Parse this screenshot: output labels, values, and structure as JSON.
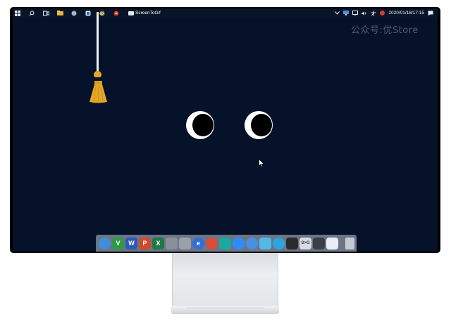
{
  "taskbar": {
    "pinned": [
      "windows-start-icon",
      "search-icon",
      "task-view-icon",
      "file-explorer-icon",
      "app-icon-1",
      "app-icon-2",
      "chrome-icon",
      "record-icon"
    ],
    "active_app_label": "ScreenToGif",
    "tray_icons": [
      "chevron-up-icon",
      "network-icon",
      "display-icon",
      "volume-icon",
      "input-icon",
      "antivirus-icon"
    ],
    "clock": "2020/01/18/17:15",
    "notification_icon": "notification-icon"
  },
  "watermark": "公众号:优Store",
  "desktop": {
    "lamp_color": "#e3a627",
    "eye_color": "#ffffff",
    "background_color": "#061229"
  },
  "dock": {
    "background_color": "#6b7587",
    "apps": [
      {
        "name": "dock-app-1",
        "color": "#3f8fd8",
        "glyph": ""
      },
      {
        "name": "dock-vim-icon",
        "color": "#2e9a46",
        "glyph": "V"
      },
      {
        "name": "dock-word-icon",
        "color": "#2b5bb7",
        "glyph": "W"
      },
      {
        "name": "dock-powerpoint-icon",
        "color": "#cf4a2b",
        "glyph": "P"
      },
      {
        "name": "dock-excel-icon",
        "color": "#1e7a45",
        "glyph": "X"
      },
      {
        "name": "dock-rocket-icon",
        "color": "#8a8f99",
        "glyph": ""
      },
      {
        "name": "dock-settings-icon",
        "color": "#9aa0a8",
        "glyph": ""
      },
      {
        "name": "dock-browser-icon",
        "color": "#2f6fd6",
        "glyph": "e"
      },
      {
        "name": "dock-chrome-icon",
        "color": "#dd4b39",
        "glyph": ""
      },
      {
        "name": "dock-app-teal-icon",
        "color": "#1aa99a",
        "glyph": ""
      },
      {
        "name": "dock-zoom-icon",
        "color": "#2d8cff",
        "glyph": ""
      },
      {
        "name": "dock-app-blue-icon",
        "color": "#4a90e2",
        "glyph": ""
      },
      {
        "name": "dock-app-multicolor-icon",
        "color": "#53b8e6",
        "glyph": ""
      },
      {
        "name": "dock-qq-icon",
        "color": "#2aa5e0",
        "glyph": ""
      },
      {
        "name": "dock-terminal-icon",
        "color": "#2b2b2b",
        "glyph": ""
      },
      {
        "name": "dock-code-icon",
        "color": "#d8dbe0",
        "glyph": "S>G"
      },
      {
        "name": "dock-monitor-icon",
        "color": "#3a3f47",
        "glyph": ""
      },
      {
        "name": "dock-control-panel-icon",
        "color": "#e8eef7",
        "glyph": ""
      },
      {
        "name": "dock-trash-icon",
        "color": "#c5cad1",
        "glyph": ""
      }
    ]
  }
}
